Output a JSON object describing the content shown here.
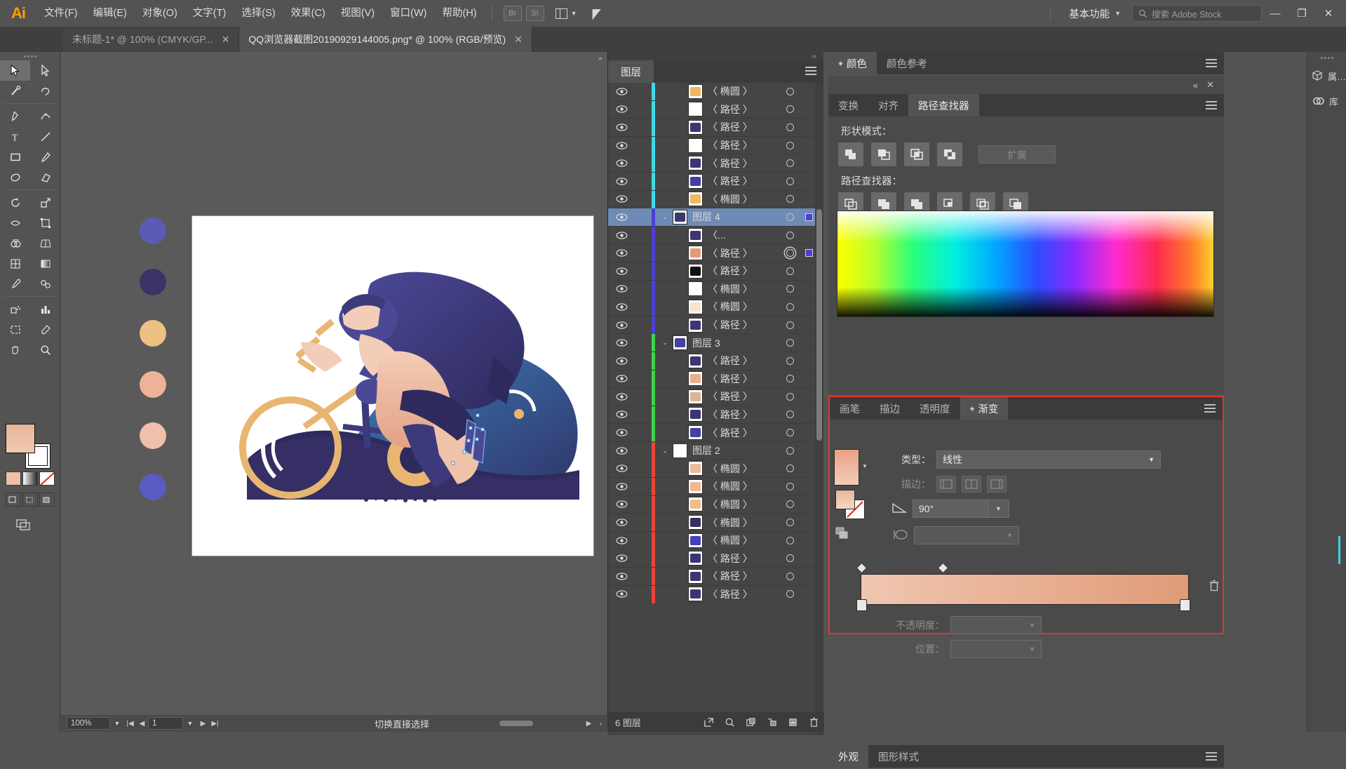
{
  "app": {
    "logo": "Ai",
    "menus": [
      "文件(F)",
      "编辑(E)",
      "对象(O)",
      "文字(T)",
      "选择(S)",
      "效果(C)",
      "视图(V)",
      "窗口(W)",
      "帮助(H)"
    ],
    "bridge_btn": "Br",
    "stock_btn": "St",
    "workspace": "基本功能",
    "search_placeholder": "搜索 Adobe Stock",
    "win_minimize": "—",
    "win_restore": "❐",
    "win_close": "✕"
  },
  "tabs": [
    {
      "title": "未标题-1* @ 100% (CMYK/GP...",
      "active": false,
      "close": "✕"
    },
    {
      "title": "QQ浏览器截图20190929144005.png* @ 100% (RGB/预览)",
      "active": true,
      "close": "✕"
    }
  ],
  "toolbox": {
    "tools": [
      "selection-tool",
      "direct-selection-tool",
      "magic-wand-tool",
      "lasso-tool",
      "pen-tool",
      "curvature-tool",
      "type-tool",
      "line-segment-tool",
      "rectangle-tool",
      "paintbrush-tool",
      "shaper-tool",
      "eraser-tool",
      "rotate-tool",
      "scale-tool",
      "width-tool",
      "free-transform-tool",
      "shape-builder-tool",
      "perspective-grid-tool",
      "mesh-tool",
      "gradient-tool",
      "eyedropper-tool",
      "blend-tool",
      "symbol-sprayer-tool",
      "column-graph-tool",
      "artboard-tool",
      "slice-tool",
      "hand-tool",
      "zoom-tool"
    ],
    "fill_color": "#eec0a6",
    "stroke_color": "#ffffff"
  },
  "canvas": {
    "zoom": "100%",
    "page": "1",
    "status_text": "切换直接选择",
    "swatch_dots": [
      "#5b5bb5",
      "#3a3566",
      "#edc083",
      "#eeb298",
      "#efc0ab",
      "#5b5bc4"
    ]
  },
  "layers_panel": {
    "tab": "图层",
    "footer_count": "6 图层",
    "footer_buttons": [
      "locate-object-icon",
      "make-clipping-mask-icon",
      "create-sublayer-icon",
      "create-new-layer-icon",
      "delete-selection-icon"
    ],
    "rows": [
      {
        "name": "〈 椭圆 〉",
        "type": "item",
        "color": "#3fd8e8",
        "thumb": "#f0b861",
        "indent": 1,
        "selected": false,
        "target": "single"
      },
      {
        "name": "〈 路径 〉",
        "type": "item",
        "color": "#3fd8e8",
        "thumb": "#ffffff",
        "indent": 1,
        "selected": false,
        "target": "single"
      },
      {
        "name": "〈 路径 〉",
        "type": "item",
        "color": "#3fd8e8",
        "thumb": "#3b3673",
        "indent": 1,
        "selected": false,
        "target": "single"
      },
      {
        "name": "〈 路径 〉",
        "type": "item",
        "color": "#3fd8e8",
        "thumb": "#ffffff",
        "indent": 1,
        "selected": false,
        "target": "single"
      },
      {
        "name": "〈 路径 〉",
        "type": "item",
        "color": "#3fd8e8",
        "thumb": "#3b3673",
        "indent": 1,
        "selected": false,
        "target": "single"
      },
      {
        "name": "〈 路径 〉",
        "type": "item",
        "color": "#3fd8e8",
        "thumb": "#4340a0",
        "indent": 1,
        "selected": false,
        "target": "single"
      },
      {
        "name": "〈 椭圆 〉",
        "type": "item",
        "color": "#3fd8e8",
        "thumb": "#f0b861",
        "indent": 1,
        "selected": false,
        "target": "single"
      },
      {
        "name": "图层 4",
        "type": "layer",
        "color": "#4b3fd6",
        "thumb": "#3b3673",
        "indent": 0,
        "selected": true,
        "target": "single",
        "has_square": true
      },
      {
        "name": "〈...",
        "type": "item",
        "color": "#4b3fd6",
        "thumb": "#3b3673",
        "indent": 1,
        "selected": false,
        "target": "single"
      },
      {
        "name": "〈 路径 〉",
        "type": "item",
        "color": "#4b3fd6",
        "thumb": "#e59b7a",
        "indent": 1,
        "selected": false,
        "target": "double",
        "has_square": true
      },
      {
        "name": "〈 路径 〉",
        "type": "item",
        "color": "#4b3fd6",
        "thumb": "#111111",
        "indent": 1,
        "selected": false,
        "target": "single"
      },
      {
        "name": "〈 椭圆 〉",
        "type": "item",
        "color": "#4b3fd6",
        "thumb": "#ffffff",
        "indent": 1,
        "selected": false,
        "target": "single"
      },
      {
        "name": "〈 椭圆 〉",
        "type": "item",
        "color": "#4b3fd6",
        "thumb": "#f6e4cf",
        "indent": 1,
        "selected": false,
        "target": "single"
      },
      {
        "name": "〈 路径 〉",
        "type": "item",
        "color": "#4b3fd6",
        "thumb": "#3b3673",
        "indent": 1,
        "selected": false,
        "target": "single"
      },
      {
        "name": "图层 3",
        "type": "layer",
        "color": "#3fd24b",
        "thumb": "#4340a0",
        "indent": 0,
        "selected": false,
        "target": "single"
      },
      {
        "name": "〈 路径 〉",
        "type": "item",
        "color": "#3fd24b",
        "thumb": "#3b3673",
        "indent": 1,
        "selected": false,
        "target": "single"
      },
      {
        "name": "〈 路径 〉",
        "type": "item",
        "color": "#3fd24b",
        "thumb": "#e7b08e",
        "indent": 1,
        "selected": false,
        "target": "single"
      },
      {
        "name": "〈 路径 〉",
        "type": "item",
        "color": "#3fd24b",
        "thumb": "#ddb49a",
        "indent": 1,
        "selected": false,
        "target": "single"
      },
      {
        "name": "〈 路径 〉",
        "type": "item",
        "color": "#3fd24b",
        "thumb": "#3b3673",
        "indent": 1,
        "selected": false,
        "target": "single"
      },
      {
        "name": "〈 路径 〉",
        "type": "item",
        "color": "#3fd24b",
        "thumb": "#4340a0",
        "indent": 1,
        "selected": false,
        "target": "single"
      },
      {
        "name": "图层 2",
        "type": "layer",
        "color": "#e8443a",
        "thumb": "#ffffff",
        "indent": 0,
        "selected": false,
        "target": "single"
      },
      {
        "name": "〈 椭圆 〉",
        "type": "item",
        "color": "#e8443a",
        "thumb": "#eebb9c",
        "indent": 1,
        "selected": false,
        "target": "single"
      },
      {
        "name": "〈 椭圆 〉",
        "type": "item",
        "color": "#e8443a",
        "thumb": "#efb98f",
        "indent": 1,
        "selected": false,
        "target": "single"
      },
      {
        "name": "〈 椭圆 〉",
        "type": "item",
        "color": "#e8443a",
        "thumb": "#f0bd86",
        "indent": 1,
        "selected": false,
        "target": "single"
      },
      {
        "name": "〈 椭圆 〉",
        "type": "item",
        "color": "#e8443a",
        "thumb": "#352f5e",
        "indent": 1,
        "selected": false,
        "target": "single"
      },
      {
        "name": "〈 椭圆 〉",
        "type": "item",
        "color": "#e8443a",
        "thumb": "#4340c0",
        "indent": 1,
        "selected": false,
        "target": "single"
      },
      {
        "name": "〈 路径 〉",
        "type": "item",
        "color": "#e8443a",
        "thumb": "#3b3673",
        "indent": 1,
        "selected": false,
        "target": "single"
      },
      {
        "name": "〈 路径 〉",
        "type": "item",
        "color": "#e8443a",
        "thumb": "#3b3673",
        "indent": 1,
        "selected": false,
        "target": "single"
      },
      {
        "name": "〈 路径 〉",
        "type": "item",
        "color": "#e8443a",
        "thumb": "#3b3673",
        "indent": 1,
        "selected": false,
        "target": "single"
      }
    ]
  },
  "color_panel": {
    "tabs": [
      {
        "label": "颜色",
        "active": true
      },
      {
        "label": "颜色参考",
        "active": false
      }
    ]
  },
  "pathfinder_panel": {
    "collapse_icon": "«",
    "close_icon": "✕",
    "tabs": [
      {
        "label": "变换",
        "active": false
      },
      {
        "label": "对齐",
        "active": false
      },
      {
        "label": "路径查找器",
        "active": true
      }
    ],
    "shape_modes_label": "形状模式：",
    "shape_mode_buttons": [
      "unite-icon",
      "minus-front-icon",
      "intersect-icon",
      "exclude-icon"
    ],
    "expand_label": "扩展",
    "pathfinders_label": "路径查找器：",
    "pathfinder_buttons": [
      "divide-icon",
      "trim-icon",
      "merge-icon",
      "crop-icon",
      "outline-icon",
      "minus-back-icon"
    ]
  },
  "gradient_panel": {
    "tabs": [
      {
        "label": "画笔",
        "active": false
      },
      {
        "label": "描边",
        "active": false
      },
      {
        "label": "透明度",
        "active": false
      },
      {
        "label": "渐变",
        "active": true
      }
    ],
    "type_label": "类型：",
    "type_value": "线性",
    "stroke_label": "描边：",
    "angle_value": "90°",
    "opacity_label": "不透明度：",
    "opacity_value": "",
    "location_label": "位置：",
    "location_value": "",
    "gradient_start": "#f2cbb4",
    "gradient_end": "#df9a77",
    "highlight_color": "#e8342a",
    "delete_icon": "delete-stop-icon"
  },
  "bottom_panel": {
    "tabs": [
      {
        "label": "外观",
        "active": true
      },
      {
        "label": "图形样式",
        "active": false
      }
    ]
  },
  "rail": {
    "items": [
      {
        "icon": "properties-icon",
        "label": "属…"
      },
      {
        "icon": "libraries-icon",
        "label": "库"
      }
    ]
  }
}
